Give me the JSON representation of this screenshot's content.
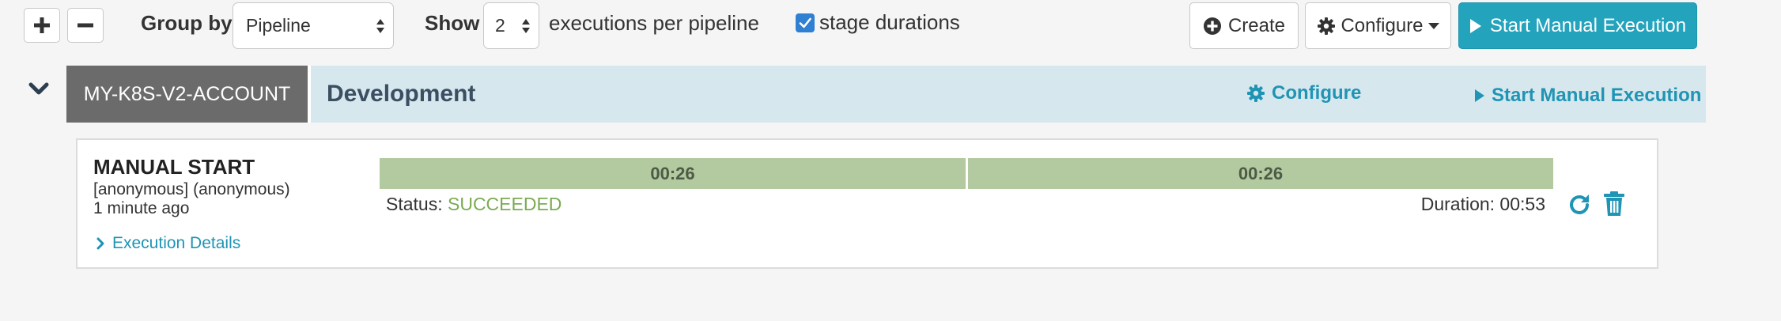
{
  "toolbar": {
    "expand_all_icon": "plus-icon",
    "collapse_all_icon": "minus-icon",
    "group_by_label": "Group by",
    "group_by_value": "Pipeline",
    "show_label": "Show",
    "show_count_value": "2",
    "executions_per_pipeline_label": "executions per pipeline",
    "stage_durations_checked": true,
    "stage_durations_label": "stage durations",
    "create_label": "Create",
    "configure_label": "Configure",
    "start_manual_execution_label": "Start Manual Execution"
  },
  "group": {
    "account": "MY-K8S-V2-ACCOUNT",
    "pipeline_name": "Development",
    "configure_label": "Configure",
    "start_manual_execution_label": "Start Manual Execution"
  },
  "execution": {
    "trigger": "MANUAL START",
    "user": "[anonymous] (anonymous)",
    "time_ago": "1 minute ago",
    "details_label": "Execution Details",
    "stages": [
      {
        "duration": "00:26",
        "status": "succeeded"
      },
      {
        "duration": "00:26",
        "status": "succeeded"
      }
    ],
    "status_label": "Status:",
    "status_value": "SUCCEEDED",
    "duration_label": "Duration: 00:53"
  },
  "colors": {
    "accent": "#24a3bd",
    "link": "#1f94b4",
    "stage_succeeded": "#b3c99f",
    "status_succeeded": "#7bab52",
    "account_tag": "#6b6b6b",
    "group_bar": "#d7e7ee"
  }
}
